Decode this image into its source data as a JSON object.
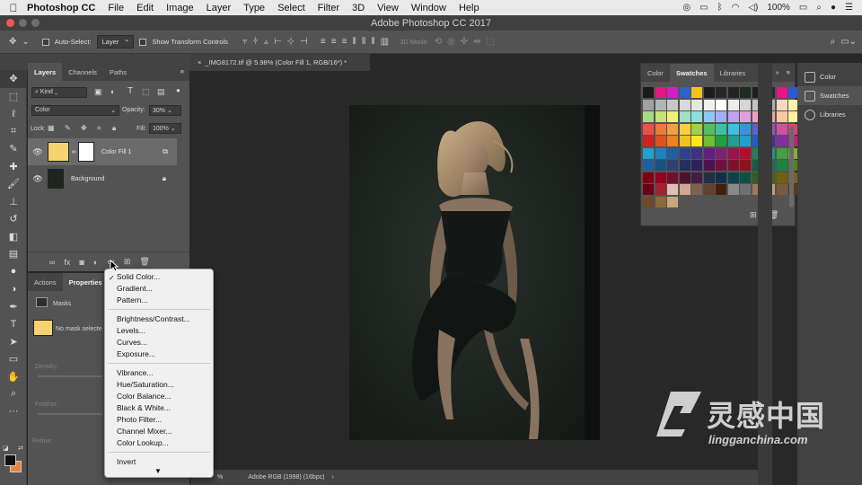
{
  "menubar": {
    "app": "Photoshop CC",
    "items": [
      "File",
      "Edit",
      "Image",
      "Layer",
      "Type",
      "Select",
      "Filter",
      "3D",
      "View",
      "Window",
      "Help"
    ],
    "battery": "100%"
  },
  "window": {
    "title": "Adobe Photoshop CC 2017"
  },
  "options": {
    "auto_select": "Auto-Select:",
    "auto_select_value": "Layer",
    "show_transform": "Show Transform Controls",
    "mode_3d": "3D Mode:"
  },
  "layers_panel": {
    "tabs": [
      "Layers",
      "Channels",
      "Paths"
    ],
    "filter": "Kind",
    "blend_mode": "Color",
    "opacity_label": "Opacity:",
    "opacity_value": "30%",
    "lock_label": "Lock:",
    "fill_label": "Fill:",
    "fill_value": "100%",
    "layers": [
      {
        "name": "Color Fill 1",
        "thumb_color": "#f6d36e"
      },
      {
        "name": "Background"
      }
    ]
  },
  "properties_panel": {
    "tabs": [
      "Actions",
      "Properties"
    ],
    "section": "Masks",
    "mask_text": "No mask selecte",
    "density_label": "Density:",
    "feather_label": "Feather:",
    "refine_label": "Refine:"
  },
  "document": {
    "tab_title": "_IMG8172.tif @ 5.98% (Color Fill 1, RGB/16*) *",
    "status_zoom": "%",
    "status_profile": "Adobe RGB (1998) (16bpc)"
  },
  "popup_menu": {
    "items": [
      [
        "Solid Color...",
        "Gradient...",
        "Pattern..."
      ],
      [
        "Brightness/Contrast...",
        "Levels...",
        "Curves...",
        "Exposure..."
      ],
      [
        "Vibrance...",
        "Hue/Saturation...",
        "Color Balance...",
        "Black & White...",
        "Photo Filter...",
        "Channel Mixer...",
        "Color Lookup..."
      ],
      [
        "Invert"
      ]
    ],
    "checked": "Solid Color..."
  },
  "swatches_panel": {
    "tabs": [
      "Color",
      "Swatches",
      "Libraries"
    ],
    "active_tab": "Swatches",
    "colors": [
      "#1a1a1a",
      "#e8147f",
      "#d81bc9",
      "#2b62c8",
      "#f2c31a",
      "#1d1d1d",
      "#262626",
      "#232323",
      "#1f2a22",
      "#1b201c",
      "#2a2a2a",
      "#e8147f",
      "#2c57d8",
      "#a0a0a0",
      "#b4b4b4",
      "#c8c8c8",
      "#d8d8d8",
      "#e6e6e6",
      "#f0f0f0",
      "#ffffff",
      "#ececec",
      "#d5d5d5",
      "#c3c3c3",
      "#b0b0b0",
      "#f9d8c0",
      "#fff3a8",
      "#a6d985",
      "#c8e07a",
      "#eef07a",
      "#9ee0c0",
      "#8ce0e0",
      "#90c8f0",
      "#a0b0f0",
      "#c0a0f0",
      "#e0a0e0",
      "#f0a0c8",
      "#f0a0a0",
      "#f8c8a0",
      "#fff0a0",
      "#e8524a",
      "#f07a3a",
      "#f0a040",
      "#f5d040",
      "#a0d050",
      "#50c060",
      "#40c0a0",
      "#40c0e0",
      "#4090e0",
      "#6060d0",
      "#a050c0",
      "#d050a0",
      "#e04070",
      "#d02020",
      "#e05020",
      "#f08020",
      "#f5c020",
      "#f8e820",
      "#70c030",
      "#20a040",
      "#20a090",
      "#20a0d0",
      "#2060c0",
      "#4030b0",
      "#8030a0",
      "#c02080",
      "#20a0d0",
      "#2080c0",
      "#2060a0",
      "#304090",
      "#403080",
      "#602080",
      "#802070",
      "#a01050",
      "#b01030",
      "#208060",
      "#209080",
      "#40a040",
      "#80b030",
      "#2060a0",
      "#1a5080",
      "#304070",
      "#203060",
      "#302060",
      "#501050",
      "#701040",
      "#801030",
      "#901020",
      "#106040",
      "#107060",
      "#208040",
      "#508020",
      "#800010",
      "#900020",
      "#701030",
      "#501030",
      "#402040",
      "#203040",
      "#103050",
      "#104050",
      "#105040",
      "#306020",
      "#506010",
      "#706010",
      "#806020",
      "#6a0010",
      "#a02030",
      "#e0c0b0",
      "#d0a890",
      "#806050",
      "#604030",
      "#402010",
      "#8a8a8a",
      "#707070",
      "#9c7a5c",
      "#c8a070",
      "#7a5a3a",
      "#5a3a1a",
      "#6e4a2a",
      "#8a6a3a",
      "#c8a878"
    ]
  },
  "right_dock": {
    "items": [
      "Color",
      "Swatches",
      "Libraries"
    ],
    "active": "Swatches"
  },
  "watermark": {
    "cn": "灵感中国",
    "url": "lingganchina.com"
  }
}
